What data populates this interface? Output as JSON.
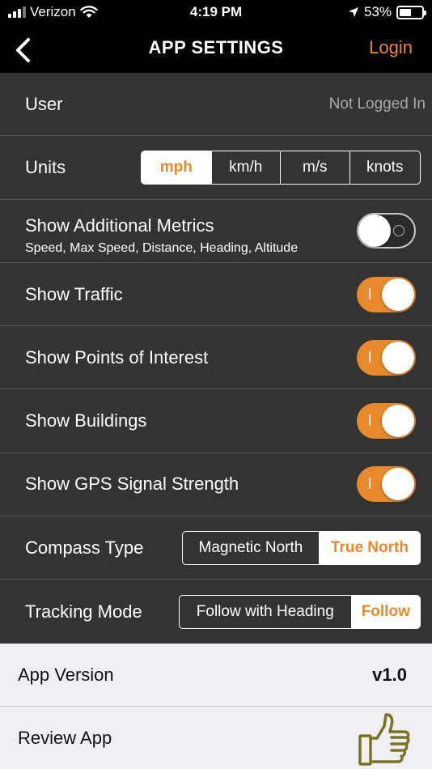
{
  "status_bar": {
    "carrier": "Verizon",
    "time": "4:19 PM",
    "battery_percent": "53%",
    "battery_level": 0.53,
    "icons": [
      "signal-icon",
      "wifi-icon",
      "location-arrow-icon",
      "battery-icon"
    ]
  },
  "nav": {
    "back_icon": "chevron-left-icon",
    "title": "APP SETTINGS",
    "login_label": "Login"
  },
  "colors": {
    "accent": "#e8892b",
    "dark_background": "#333333",
    "light_background": "#efeff4",
    "thumbs_up_icon": "#7a7420"
  },
  "settings": {
    "user": {
      "label": "User",
      "value": "Not Logged In"
    },
    "units": {
      "label": "Units",
      "options": [
        "mph",
        "km/h",
        "m/s",
        "knots"
      ],
      "selected": "mph"
    },
    "additional_metrics": {
      "label": "Show Additional Metrics",
      "sublabel": "Speed, Max Speed, Distance, Heading, Altitude",
      "on": false
    },
    "traffic": {
      "label": "Show Traffic",
      "on": true
    },
    "points_of_interest": {
      "label": "Show Points of Interest",
      "on": true
    },
    "buildings": {
      "label": "Show Buildings",
      "on": true
    },
    "gps_signal": {
      "label": "Show GPS Signal Strength",
      "on": true
    },
    "compass_type": {
      "label": "Compass Type",
      "options": [
        "Magnetic North",
        "True North"
      ],
      "selected": "True North"
    },
    "tracking_mode": {
      "label": "Tracking Mode",
      "options": [
        "Follow with Heading",
        "Follow"
      ],
      "selected": "Follow"
    }
  },
  "about": {
    "version_label": "App Version",
    "version_value": "v1.0",
    "review_label": "Review App",
    "review_icon": "thumbs-up-icon"
  }
}
